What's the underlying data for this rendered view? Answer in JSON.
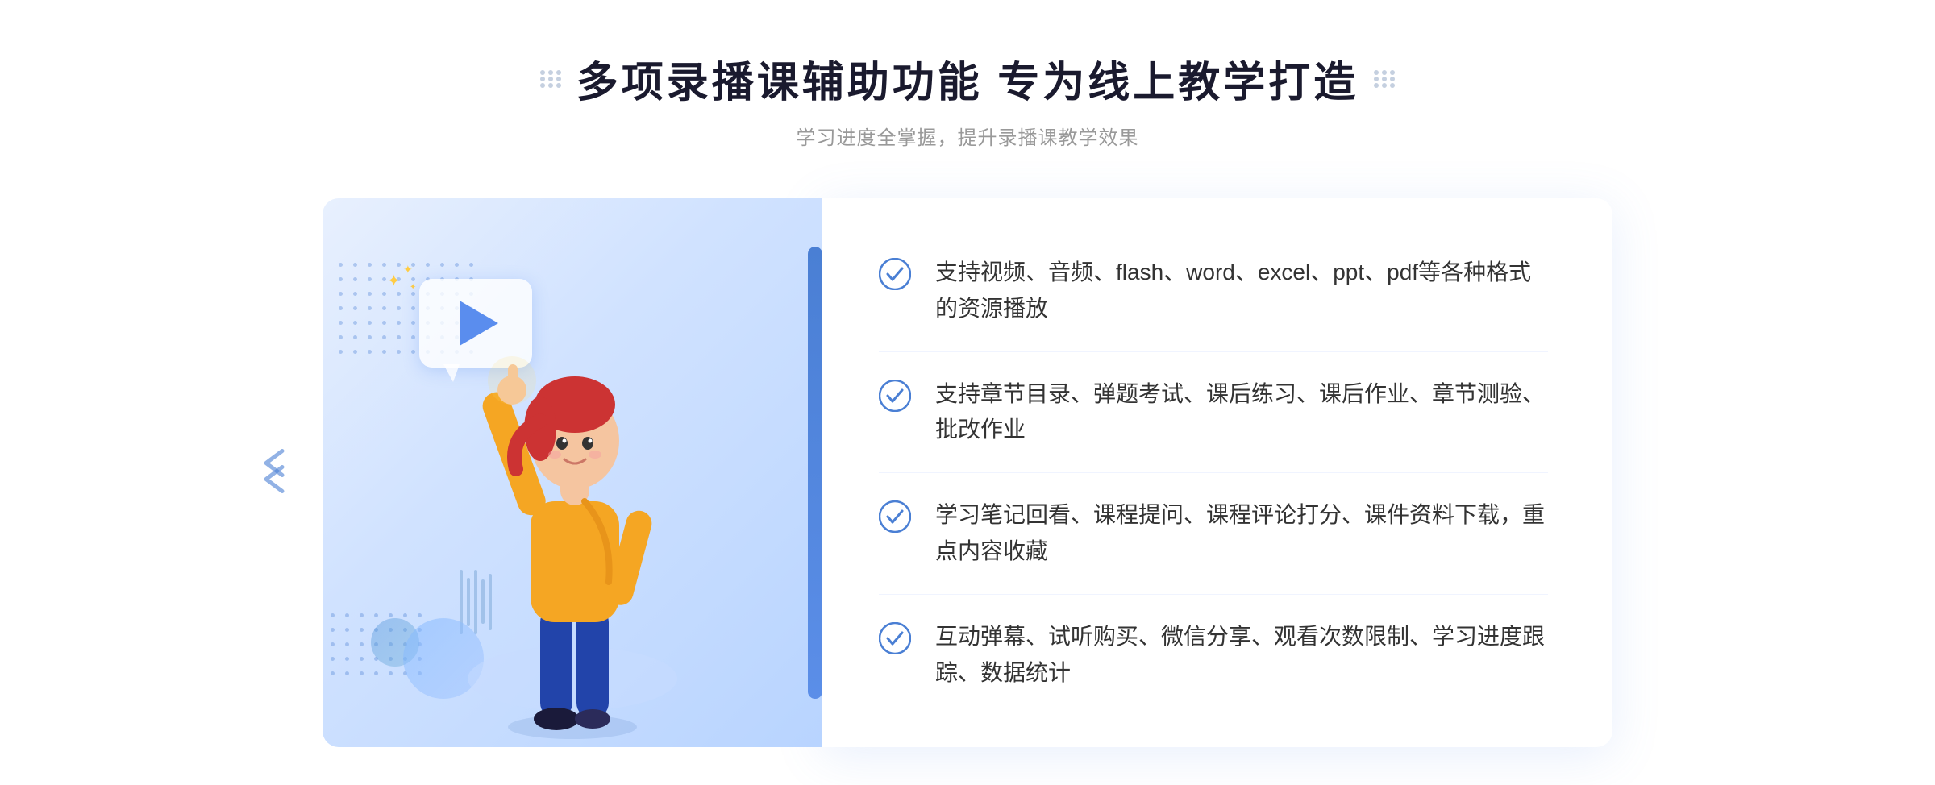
{
  "page": {
    "background": "#ffffff"
  },
  "header": {
    "main_title": "多项录播课辅助功能 专为线上教学打造",
    "sub_title": "学习进度全掌握，提升录播课教学效果",
    "decorator_left": "⁝⁝",
    "decorator_right": "⁝⁝"
  },
  "features": [
    {
      "id": 1,
      "text": "支持视频、音频、flash、word、excel、ppt、pdf等各种格式的资源播放"
    },
    {
      "id": 2,
      "text": "支持章节目录、弹题考试、课后练习、课后作业、章节测验、批改作业"
    },
    {
      "id": 3,
      "text": "学习笔记回看、课程提问、课程评论打分、课件资料下载，重点内容收藏"
    },
    {
      "id": 4,
      "text": "互动弹幕、试听购买、微信分享、观看次数限制、学习进度跟踪、数据统计"
    }
  ],
  "icons": {
    "check": "check-circle-icon",
    "play": "play-icon",
    "chevron": "chevron-left-icon"
  },
  "colors": {
    "primary": "#4a7fd4",
    "text_dark": "#1a1a2e",
    "text_gray": "#999999",
    "text_feature": "#333333",
    "bg_light": "#f5f8ff"
  }
}
